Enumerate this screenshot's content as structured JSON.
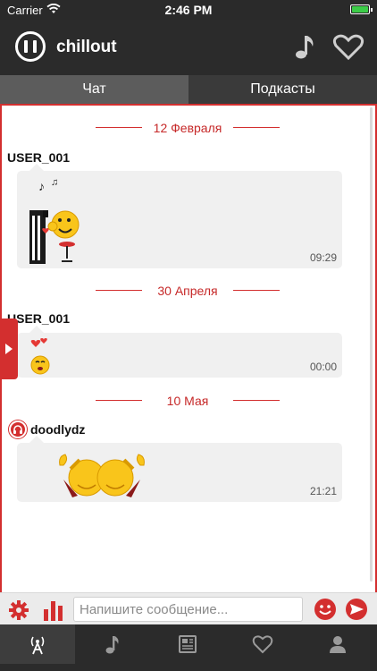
{
  "statusbar": {
    "carrier": "Carrier",
    "time": "2:46 PM",
    "battery_level": 1.0
  },
  "header": {
    "title": "chillout"
  },
  "tabs": [
    {
      "label": "Чат",
      "active": true
    },
    {
      "label": "Подкасты",
      "active": false
    }
  ],
  "dates": [
    "12 Февраля",
    "30 Апреля",
    "10 Мая"
  ],
  "messages": [
    {
      "user": "USER_001",
      "time": "09:29",
      "content": "piano-emoji-sticker"
    },
    {
      "user": "USER_001",
      "time": "00:00",
      "content": "love-smiley-sticker"
    },
    {
      "user": "doodlydz",
      "time": "21:21",
      "content": "dancing-smileys-sticker"
    }
  ],
  "input": {
    "placeholder": "Напишите сообщение..."
  },
  "icons": {
    "logo": "pause-circle-icon",
    "header_right": [
      "music-note-icon",
      "heart-icon"
    ],
    "inputbar": [
      "gear-icon",
      "equalizer-icon",
      "smiley-icon",
      "send-icon"
    ],
    "bottomnav": [
      "radio-tower-icon",
      "music-note-icon",
      "news-icon",
      "heart-icon",
      "user-icon"
    ]
  },
  "colors": {
    "accent": "#d32f2f",
    "header_bg": "#2b2b2b",
    "bubble_bg": "#f0f0f0"
  }
}
